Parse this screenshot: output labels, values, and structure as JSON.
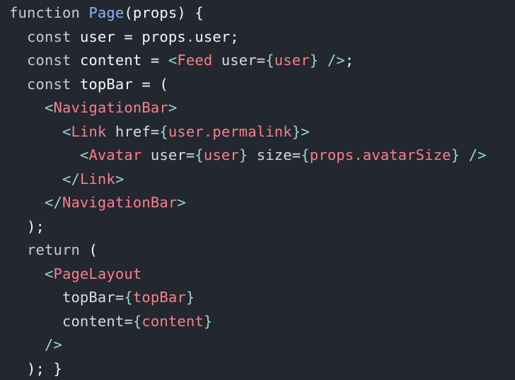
{
  "code": {
    "lines": [
      [
        {
          "t": "function ",
          "k": "keyword"
        },
        {
          "t": "Page",
          "k": "function"
        },
        {
          "t": "(props) {",
          "k": "plain"
        }
      ],
      [
        {
          "t": "  const ",
          "k": "keyword"
        },
        {
          "t": "user = props",
          "k": "plain"
        },
        {
          "t": ".",
          "k": "punct"
        },
        {
          "t": "user;",
          "k": "plain"
        }
      ],
      [
        {
          "t": "  const ",
          "k": "keyword"
        },
        {
          "t": "content = ",
          "k": "plain"
        },
        {
          "t": "<",
          "k": "punct"
        },
        {
          "t": "Feed",
          "k": "tag"
        },
        {
          "t": " user=",
          "k": "attr"
        },
        {
          "t": "{",
          "k": "punct"
        },
        {
          "t": "user",
          "k": "tag"
        },
        {
          "t": "} />",
          "k": "punct"
        },
        {
          "t": ";",
          "k": "plain"
        }
      ],
      [
        {
          "t": "  const ",
          "k": "keyword"
        },
        {
          "t": "topBar = (",
          "k": "plain"
        }
      ],
      [
        {
          "t": "    ",
          "k": "plain"
        },
        {
          "t": "<",
          "k": "punct"
        },
        {
          "t": "NavigationBar",
          "k": "tag"
        },
        {
          "t": ">",
          "k": "punct"
        }
      ],
      [
        {
          "t": "      ",
          "k": "plain"
        },
        {
          "t": "<",
          "k": "punct"
        },
        {
          "t": "Link",
          "k": "tag"
        },
        {
          "t": " href=",
          "k": "attr"
        },
        {
          "t": "{",
          "k": "punct"
        },
        {
          "t": "user.permalink",
          "k": "tag"
        },
        {
          "t": "}>",
          "k": "punct"
        }
      ],
      [
        {
          "t": "        ",
          "k": "plain"
        },
        {
          "t": "<",
          "k": "punct"
        },
        {
          "t": "Avatar",
          "k": "tag"
        },
        {
          "t": " user=",
          "k": "attr"
        },
        {
          "t": "{",
          "k": "punct"
        },
        {
          "t": "user",
          "k": "tag"
        },
        {
          "t": "}",
          "k": "punct"
        },
        {
          "t": " size=",
          "k": "attr"
        },
        {
          "t": "{",
          "k": "punct"
        },
        {
          "t": "props.avatarSize",
          "k": "tag"
        },
        {
          "t": "} />",
          "k": "punct"
        }
      ],
      [
        {
          "t": "      ",
          "k": "plain"
        },
        {
          "t": "</",
          "k": "punct"
        },
        {
          "t": "Link",
          "k": "tag"
        },
        {
          "t": ">",
          "k": "punct"
        }
      ],
      [
        {
          "t": "    ",
          "k": "plain"
        },
        {
          "t": "</",
          "k": "punct"
        },
        {
          "t": "NavigationBar",
          "k": "tag"
        },
        {
          "t": ">",
          "k": "punct"
        }
      ],
      [
        {
          "t": "  );",
          "k": "plain"
        }
      ],
      [
        {
          "t": "  return ",
          "k": "keyword"
        },
        {
          "t": "(",
          "k": "plain"
        }
      ],
      [
        {
          "t": "    ",
          "k": "plain"
        },
        {
          "t": "<",
          "k": "punct"
        },
        {
          "t": "PageLayout",
          "k": "tag"
        }
      ],
      [
        {
          "t": "      topBar=",
          "k": "attr"
        },
        {
          "t": "{",
          "k": "punct"
        },
        {
          "t": "topBar",
          "k": "tag"
        },
        {
          "t": "}",
          "k": "punct"
        }
      ],
      [
        {
          "t": "      content=",
          "k": "attr"
        },
        {
          "t": "{",
          "k": "punct"
        },
        {
          "t": "content",
          "k": "tag"
        },
        {
          "t": "}",
          "k": "punct"
        }
      ],
      [
        {
          "t": "    ",
          "k": "plain"
        },
        {
          "t": "/>",
          "k": "punct"
        }
      ],
      [
        {
          "t": "  ); }",
          "k": "plain"
        }
      ]
    ]
  },
  "theme": {
    "background": "#23272f",
    "keyword": "#c6cbd5",
    "function": "#86b7f8",
    "tag": "#f97f8d",
    "punct": "#9ad8d2",
    "attr": "#d7dbe2",
    "plain": "#f5f6f8"
  }
}
